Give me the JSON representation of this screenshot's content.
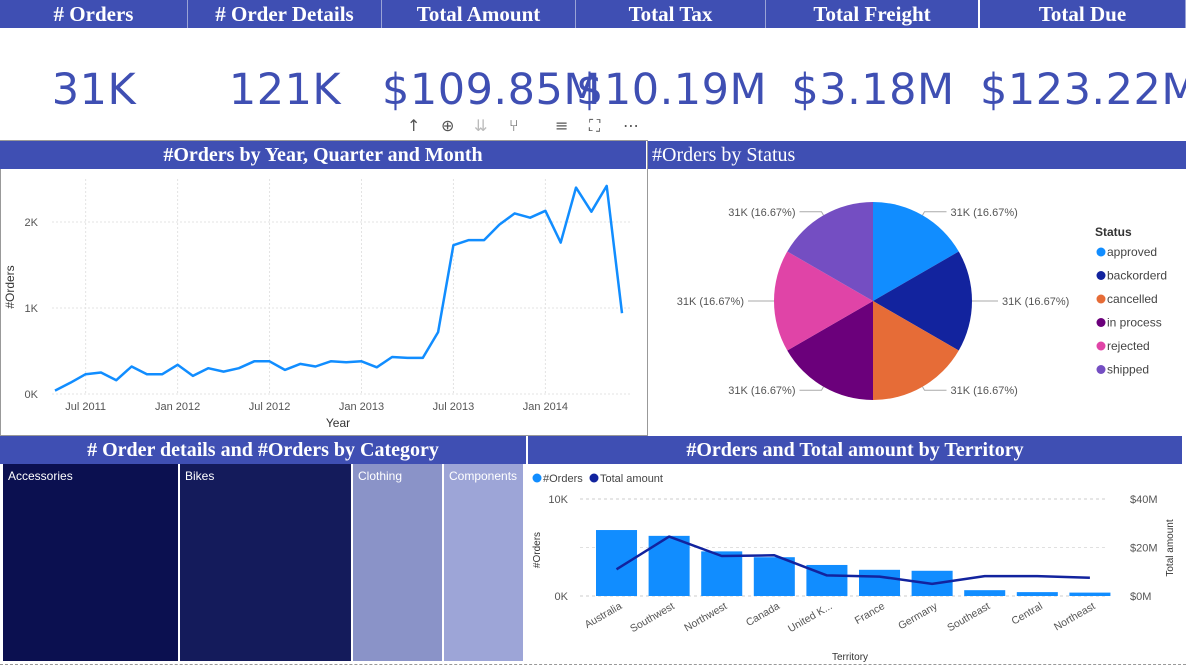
{
  "kpis": [
    {
      "label": "# Orders",
      "value": "31K"
    },
    {
      "label": "# Order Details",
      "value": "121K"
    },
    {
      "label": "Total Amount",
      "value": "$109.85M"
    },
    {
      "label": "Total Tax",
      "value": "$10.19M"
    },
    {
      "label": "Total Freight",
      "value": "$3.18M"
    },
    {
      "label": "Total Due",
      "value": "$123.22M"
    }
  ],
  "toolbar": {
    "icons": [
      "arrow-up-icon",
      "drill-down-icon",
      "expand-down-icon",
      "fork-icon",
      "filter-icon",
      "focus-mode-icon",
      "more-options-icon"
    ],
    "glyphs": [
      "↑",
      "⊕",
      "⇊",
      "⑂",
      "≡",
      "⛶",
      "⋯"
    ]
  },
  "panels": {
    "line": {
      "title": "#Orders by Year, Quarter and Month"
    },
    "pie": {
      "title": "#Orders by Status"
    },
    "treemap": {
      "title": "# Order details and #Orders by Category"
    },
    "combo": {
      "title": "#Orders and Total amount by Territory"
    }
  },
  "chart_data": [
    {
      "type": "line",
      "title": "#Orders by Year, Quarter and Month",
      "xlabel": "Year",
      "ylabel": "#Orders",
      "x_ticks": [
        "Jul 2011",
        "Jan 2012",
        "Jul 2012",
        "Jan 2013",
        "Jul 2013",
        "Jan 2014"
      ],
      "y_ticks": [
        "0K",
        "1K",
        "2K"
      ],
      "ylim": [
        0,
        2500
      ],
      "x": [
        "May 2011",
        "Jun 2011",
        "Jul 2011",
        "Aug 2011",
        "Sep 2011",
        "Oct 2011",
        "Nov 2011",
        "Dec 2011",
        "Jan 2012",
        "Feb 2012",
        "Mar 2012",
        "Apr 2012",
        "May 2012",
        "Jun 2012",
        "Jul 2012",
        "Aug 2012",
        "Sep 2012",
        "Oct 2012",
        "Nov 2012",
        "Dec 2012",
        "Jan 2013",
        "Feb 2013",
        "Mar 2013",
        "Apr 2013",
        "May 2013",
        "Jun 2013",
        "Jul 2013",
        "Aug 2013",
        "Sep 2013",
        "Oct 2013",
        "Nov 2013",
        "Dec 2013",
        "Jan 2014",
        "Feb 2014",
        "Mar 2014",
        "Apr 2014",
        "May 2014",
        "Jun 2014"
      ],
      "values": [
        40,
        130,
        230,
        250,
        160,
        320,
        230,
        230,
        340,
        210,
        300,
        260,
        300,
        380,
        380,
        280,
        350,
        320,
        380,
        370,
        380,
        310,
        430,
        420,
        420,
        720,
        1730,
        1790,
        1790,
        1970,
        2100,
        2050,
        2130,
        1760,
        2400,
        2120,
        2420,
        940
      ],
      "color": "#118dff",
      "grid": true
    },
    {
      "type": "pie",
      "title": "#Orders by Status",
      "legend_title": "Status",
      "legend_position": "right",
      "categories": [
        "approved",
        "backorderd",
        "cancelled",
        "in process",
        "rejected",
        "shipped"
      ],
      "values": [
        16.67,
        16.67,
        16.67,
        16.67,
        16.67,
        16.67
      ],
      "data_labels": [
        "31K (16.67%)",
        "31K (16.67%)",
        "31K (16.67%)",
        "31K (16.67%)",
        "31K (16.67%)",
        "31K (16.67%)"
      ],
      "colors": [
        "#118dff",
        "#12239e",
        "#e66c37",
        "#6b007b",
        "#e044a7",
        "#744ec2"
      ]
    },
    {
      "type": "treemap",
      "title": "# Order details and #Orders by Category",
      "categories": [
        "Accessories",
        "Bikes",
        "Clothing",
        "Components"
      ],
      "colors": [
        "#0b1050",
        "#141b5b",
        "#8a93c8",
        "#9da5d7"
      ]
    },
    {
      "type": "bar",
      "title": "#Orders and Total amount by Territory",
      "xlabel": "Territory",
      "ylabel": "#Orders",
      "y2label": "Total amount",
      "legend_position": "top-left",
      "categories": [
        "Australia",
        "Southwest",
        "Northwest",
        "Canada",
        "United K...",
        "France",
        "Germany",
        "Southeast",
        "Central",
        "Northeast"
      ],
      "y_ticks": [
        "0K",
        "10K"
      ],
      "y2_ticks": [
        "$0M",
        "$20M",
        "$40M"
      ],
      "ylim": [
        0,
        10000
      ],
      "y2lim": [
        0,
        40000000
      ],
      "series": [
        {
          "name": "#Orders",
          "type": "bar",
          "color": "#118dff",
          "values": [
            6800,
            6200,
            4600,
            4000,
            3200,
            2700,
            2600,
            600,
            400,
            350
          ]
        },
        {
          "name": "Total amount",
          "type": "line",
          "color": "#12239e",
          "values": [
            11000000,
            24500000,
            16500000,
            16800000,
            8500000,
            8000000,
            5000000,
            8200000,
            8200000,
            7500000
          ]
        }
      ]
    }
  ]
}
